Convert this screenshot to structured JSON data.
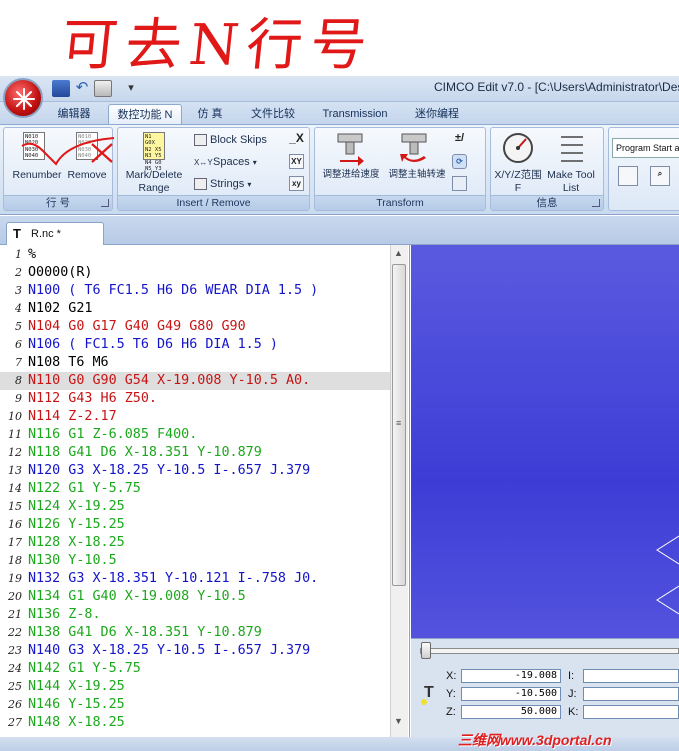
{
  "annotation": {
    "handwriting": "可去N行号"
  },
  "titlebar": {
    "title": "CIMCO Edit v7.0 - [C:\\Users\\Administrator\\Des"
  },
  "ribbon_tabs": [
    {
      "label": "编辑器"
    },
    {
      "label": "数控功能 N"
    },
    {
      "label": "仿 真"
    },
    {
      "label": "文件比较"
    },
    {
      "label": "Transmission"
    },
    {
      "label": "迷你编程"
    }
  ],
  "ribbon": {
    "renumber_label": "Renumber",
    "remove_label": "Remove",
    "group_line_numbers": "行 号",
    "mark_delete_label_1": "Mark/Delete",
    "mark_delete_label_2": "Range",
    "block_skips": "Block Skips",
    "spaces": "Spaces",
    "strings": "Strings",
    "group_insert_remove": "Insert / Remove",
    "adjust_feed": "调整进给速度",
    "adjust_spindle": "调整主轴转速",
    "group_transform": "Transform",
    "xyz_range_1": "X/Y/Z范围",
    "xyz_range_2": "F",
    "make_tool_1": "Make Tool",
    "make_tool_2": "List",
    "group_info": "信息",
    "program_start": "Program Start and"
  },
  "doc_tab": {
    "label": "R.nc *"
  },
  "editor": {
    "lines": [
      {
        "num": "1",
        "text": "%",
        "color": "#000000"
      },
      {
        "num": "2",
        "text": "O0000(R)",
        "color": "#000000"
      },
      {
        "num": "3",
        "text": "N100 ( T6 FC1.5 H6 D6 WEAR DIA 1.5 )",
        "color": "#1414c8"
      },
      {
        "num": "4",
        "text": "N102 G21",
        "color": "#000000"
      },
      {
        "num": "5",
        "text": "N104 G0 G17 G40 G49 G80 G90",
        "color": "#c81414"
      },
      {
        "num": "6",
        "text": "N106 ( FC1.5 T6 D6 H6 DIA 1.5 )",
        "color": "#1414c8"
      },
      {
        "num": "7",
        "text": "N108 T6 M6",
        "color": "#000000"
      },
      {
        "num": "8",
        "text": "N110 G0 G90 G54 X-19.008 Y-10.5 A0.",
        "color": "#c81414"
      },
      {
        "num": "9",
        "text": "N112 G43 H6 Z50.",
        "color": "#c81414"
      },
      {
        "num": "10",
        "text": "N114 Z-2.17",
        "color": "#c81414"
      },
      {
        "num": "11",
        "text": "N116 G1 Z-6.085 F400.",
        "color": "#1ca81c"
      },
      {
        "num": "12",
        "text": "N118 G41 D6 X-18.351 Y-10.879",
        "color": "#1ca81c"
      },
      {
        "num": "13",
        "text": "N120 G3 X-18.25 Y-10.5 I-.657 J.379",
        "color": "#1414c8"
      },
      {
        "num": "14",
        "text": "N122 G1 Y-5.75",
        "color": "#1ca81c"
      },
      {
        "num": "15",
        "text": "N124 X-19.25",
        "color": "#1ca81c"
      },
      {
        "num": "16",
        "text": "N126 Y-15.25",
        "color": "#1ca81c"
      },
      {
        "num": "17",
        "text": "N128 X-18.25",
        "color": "#1ca81c"
      },
      {
        "num": "18",
        "text": "N130 Y-10.5",
        "color": "#1ca81c"
      },
      {
        "num": "19",
        "text": "N132 G3 X-18.351 Y-10.121 I-.758 J0.",
        "color": "#1414c8"
      },
      {
        "num": "20",
        "text": "N134 G1 G40 X-19.008 Y-10.5",
        "color": "#1ca81c"
      },
      {
        "num": "21",
        "text": "N136 Z-8.",
        "color": "#1ca81c"
      },
      {
        "num": "22",
        "text": "N138 G41 D6 X-18.351 Y-10.879",
        "color": "#1ca81c"
      },
      {
        "num": "23",
        "text": "N140 G3 X-18.25 Y-10.5 I-.657 J.379",
        "color": "#1414c8"
      },
      {
        "num": "24",
        "text": "N142 G1 Y-5.75",
        "color": "#1ca81c"
      },
      {
        "num": "25",
        "text": "N144 X-19.25",
        "color": "#1ca81c"
      },
      {
        "num": "26",
        "text": "N146 Y-15.25",
        "color": "#1ca81c"
      },
      {
        "num": "27",
        "text": "N148 X-18.25",
        "color": "#1ca81c"
      }
    ],
    "current_line_num": "8"
  },
  "coords": {
    "x_label": "X:",
    "x_value": "-19.008",
    "y_label": "Y:",
    "y_value": "-10.500",
    "z_label": "Z:",
    "z_value": "50.000",
    "i_label": "I:",
    "j_label": "J:",
    "k_label": "K:"
  },
  "watermark": "三维网www.3dportal.cn",
  "colors": {
    "accent": "#3d3dd6",
    "red_code": "#c81414",
    "blue_code": "#1414c8",
    "green_code": "#1ca81c"
  }
}
